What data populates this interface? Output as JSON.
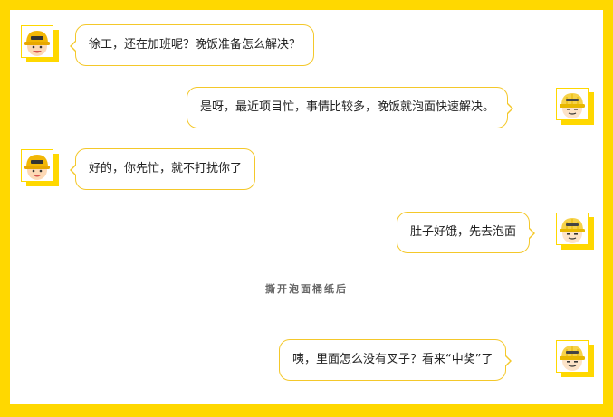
{
  "colors": {
    "frame": "#FFD800",
    "bubble_border": "#F4C82A",
    "text": "#222222",
    "note_text": "#666666"
  },
  "messages": [
    {
      "side": "left",
      "avatar": "coworker-avatar-icon",
      "text": "徐工，还在加班呢？晚饭准备怎么解决？"
    },
    {
      "side": "right",
      "avatar": "engineer-avatar-icon",
      "text": "是呀，最近项目忙，事情比较多，晚饭就泡面快速解决。"
    },
    {
      "side": "left",
      "avatar": "coworker-avatar-icon",
      "text": "好的，你先忙，就不打扰你了"
    },
    {
      "side": "right",
      "avatar": "engineer-avatar-icon",
      "text": "肚子好饿，先去泡面"
    },
    {
      "side": "right",
      "avatar": "engineer-avatar-icon",
      "text": "咦，里面怎么没有叉子？看来“中奖”了"
    }
  ],
  "center_note": "撕开泡面桶纸后"
}
